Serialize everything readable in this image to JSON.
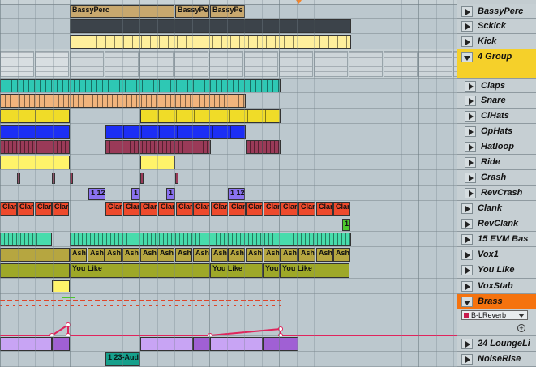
{
  "colors": {
    "tan": "#c8a86e",
    "dark": "#3c434a",
    "cream": "#ffef9c",
    "teal": "#2ec8b4",
    "peach": "#f1b47c",
    "yellow": "#f0dc28",
    "blue": "#1c2ef5",
    "maroon": "#9a3a58",
    "lightyellow": "#fff36a",
    "violet": "#8a72f0",
    "red": "#ee4a2c",
    "green": "#4cc82c",
    "mint": "#48dcac",
    "olive": "#b6a640",
    "lime": "#9ea828",
    "lavender": "#c8a4f4",
    "purple": "#a060d4",
    "darkteal": "#16a08c",
    "group": "#f5d02a",
    "brass": "#f5730f"
  },
  "clips": {
    "bassyperc": [
      "BassyPerc",
      "BassyPe",
      "BassyPe"
    ],
    "revcrash": [
      "1 12",
      "1",
      "1",
      "1 12"
    ],
    "clank": "Clar",
    "revclank": "1",
    "vox1": "Ash",
    "youlike": [
      "You Like",
      "You Like",
      "You",
      "You Like"
    ],
    "noiserise": "1 23-Aud"
  },
  "tracks": [
    {
      "name": "BassyPerc"
    },
    {
      "name": "Sckick"
    },
    {
      "name": "Kick"
    },
    {
      "name": "4 Group"
    },
    {
      "name": "Claps"
    },
    {
      "name": "Snare"
    },
    {
      "name": "ClHats"
    },
    {
      "name": "OpHats"
    },
    {
      "name": "Hatloop"
    },
    {
      "name": "Ride"
    },
    {
      "name": "Crash"
    },
    {
      "name": "RevCrash"
    },
    {
      "name": "Clank"
    },
    {
      "name": "RevClank"
    },
    {
      "name": "15 EVM Bas"
    },
    {
      "name": "Vox1"
    },
    {
      "name": "You Like"
    },
    {
      "name": "VoxStab"
    },
    {
      "name": "Brass",
      "device": "B-LReverb"
    },
    {
      "name": "24 LoungeLi"
    },
    {
      "name": "NoiseRise"
    }
  ],
  "icons": {
    "fold": "triangle-right-icon",
    "add": "plus-circle-icon",
    "playhead": "loop-marker-icon"
  }
}
